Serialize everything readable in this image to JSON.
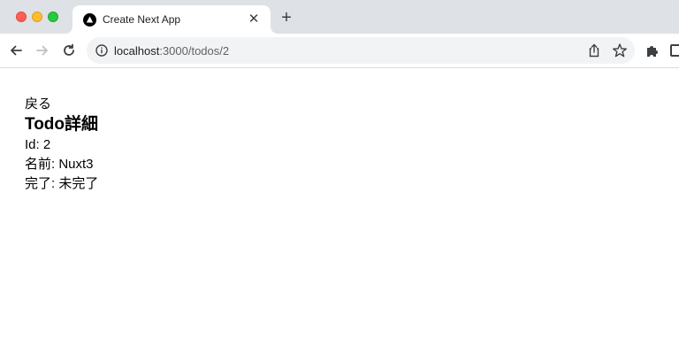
{
  "browser": {
    "tab": {
      "title": "Create Next App",
      "close_glyph": "✕"
    },
    "new_tab_glyph": "+",
    "address": {
      "host": "localhost",
      "path": ":3000/todos/2"
    }
  },
  "page": {
    "back_link": "戻る",
    "title": "Todo詳細",
    "details": [
      {
        "text": "Id: 2"
      },
      {
        "text": "名前: Nuxt3"
      },
      {
        "text": "完了: 未完了"
      }
    ]
  },
  "colors": {
    "tab_strip": "#dee1e6",
    "omnibox": "#f1f3f4",
    "traffic_close": "#ff5f57",
    "traffic_minimize": "#febc2e",
    "traffic_maximize": "#28c840"
  }
}
